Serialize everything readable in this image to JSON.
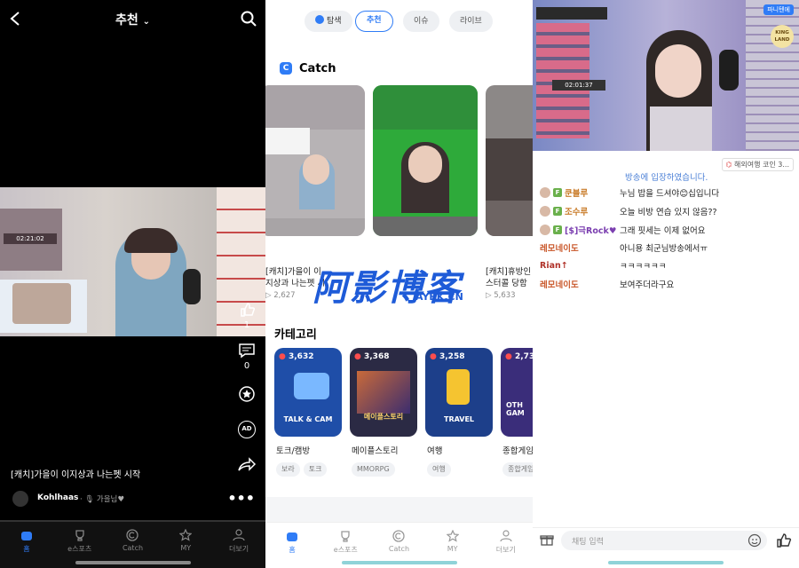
{
  "panel1": {
    "header_title": "추천",
    "stream_overlay": {
      "time": "02:21:02"
    },
    "rail": {
      "likes": "1",
      "comments": "0",
      "ad_label": "AD"
    },
    "caption": "[캐치]가을이 이지상과 나는펫 시작",
    "channel_name": "Kohlhaas",
    "channel_sub": "가을님♥",
    "tabs": [
      "홈",
      "e스포츠",
      "Catch",
      "MY",
      "더보기"
    ]
  },
  "panel2": {
    "chips": [
      "탐색",
      "추천",
      "이슈",
      "라이브"
    ],
    "catch_title": "Catch",
    "catch_cards": [
      {
        "title": "[캐치]가을이 이지상과 나는펫 시작",
        "views": "2,627"
      },
      {
        "title": "",
        "views": ""
      },
      {
        "title": "[캐치]휴방인 스터콜 당함",
        "views": "5,633"
      }
    ],
    "category_title": "카테고리",
    "categories": [
      {
        "count": "3,632",
        "name": "토크/캠방",
        "art": "TALK & CAM",
        "tags": [
          "보라",
          "토크"
        ],
        "color": "#1f4ea8"
      },
      {
        "count": "3,368",
        "name": "메이플스토리",
        "art": "메이플스토리",
        "tags": [
          "MMORPG"
        ],
        "color": "#2b2a44"
      },
      {
        "count": "3,258",
        "name": "여행",
        "art": "TRAVEL",
        "tags": [
          "여행"
        ],
        "color": "#1d3f8a"
      },
      {
        "count": "2,731",
        "name": "종합게임",
        "art": "OTH GAM",
        "tags": [
          "종합게임"
        ],
        "color": "#3a2d7a"
      }
    ],
    "tabs": [
      "홈",
      "e스포츠",
      "Catch",
      "MY",
      "더보기"
    ]
  },
  "watermark": {
    "main": "阿影博客",
    "sub": "AYBK.CN"
  },
  "panel3": {
    "stream_time": "02:01:37",
    "top_right_tag": "파니텐에",
    "corner_logo": "KING LAND",
    "entered_notice": "방송에 입장하였습니다.",
    "promo_chip": "해외여행 코인 3...",
    "chat": [
      {
        "nick": "쿤블루",
        "msg": "누님 밥을 드셔야😊십입니다",
        "color": "#c97c2a",
        "avatar": true,
        "badge": true
      },
      {
        "nick": "조수루",
        "msg": "오늘 비방 연습 있지 않음??",
        "color": "#c97c2a",
        "avatar": true,
        "badge": true
      },
      {
        "nick": "[$]극Rock♥",
        "msg": "그래 핏세는 이제 없어요",
        "color": "#7b3fb0",
        "avatar": true,
        "badge": true
      },
      {
        "nick": "레모네이도",
        "msg": "아니용 최군님방송에서ㅠ",
        "color": "#c9572a",
        "avatar": false,
        "badge": false
      },
      {
        "nick": "Rian↑",
        "msg": "ㅋㅋㅋㅋㅋㅋ",
        "color": "#b0332a",
        "avatar": false,
        "badge": false
      },
      {
        "nick": "레모네이도",
        "msg": "보여주더라구요",
        "color": "#c9572a",
        "avatar": false,
        "badge": false
      }
    ],
    "input_placeholder": "채팅 입력"
  }
}
